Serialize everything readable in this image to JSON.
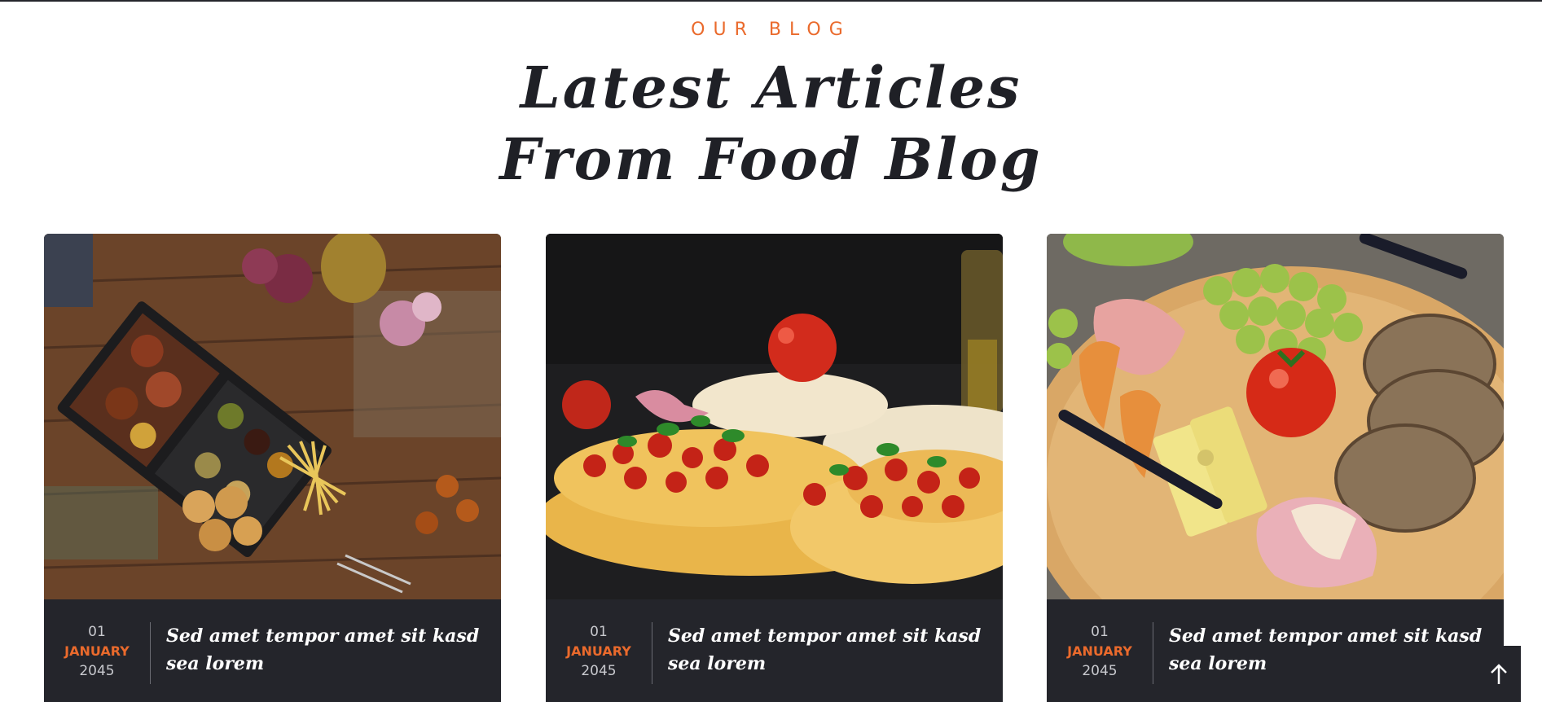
{
  "section": {
    "eyebrow": "OUR BLOG",
    "headline_line1": "Latest Articles",
    "headline_line2": "From Food Blog"
  },
  "posts": [
    {
      "image": "bbq-grill-platter-photo",
      "day": "01",
      "month": "JANUARY",
      "year": "2045",
      "title": "Sed amet tempor amet sit kasd sea lorem"
    },
    {
      "image": "bruschetta-tomato-basil-photo",
      "day": "01",
      "month": "JANUARY",
      "year": "2045",
      "title": "Sed amet tempor amet sit kasd sea lorem"
    },
    {
      "image": "cheese-grapes-bread-board-photo",
      "day": "01",
      "month": "JANUARY",
      "year": "2045",
      "title": "Sed amet tempor amet sit kasd sea lorem"
    }
  ],
  "back_to_top": {
    "icon": "arrow-up-icon"
  },
  "colors": {
    "accent": "#ea6a2c",
    "dark": "#24252b",
    "heading": "#1f2026"
  }
}
